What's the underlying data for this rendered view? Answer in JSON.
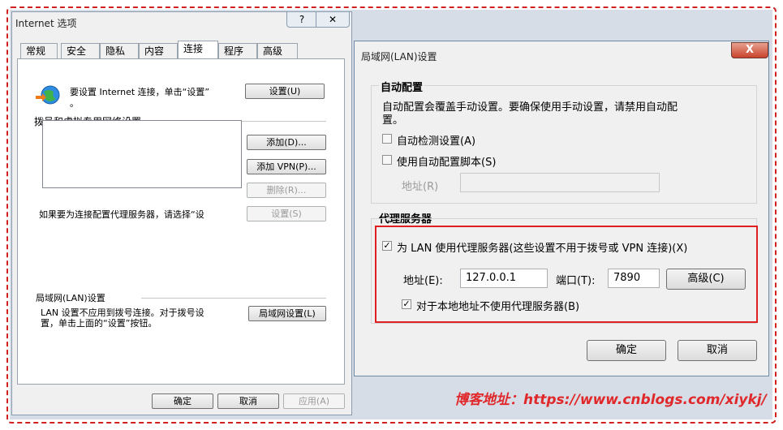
{
  "internet_options": {
    "title": "Internet 选项",
    "help_label": "?",
    "close_label": "✕",
    "tabs": [
      "常规",
      "安全",
      "隐私",
      "内容",
      "连接",
      "程序",
      "高级"
    ],
    "active_tab": "连接",
    "setup_text_1": "要设置 Internet 连接，单击“设置”",
    "setup_text_2": "。",
    "setup_button": "设置(U)",
    "dialup_group": "拨号和虚拟专用网络设置",
    "add_button": "添加(D)...",
    "add_vpn_button": "添加 VPN(P)...",
    "remove_button": "删除(R)...",
    "settings_button": "设置(S)",
    "proxy_hint": "如果要为连接配置代理服务器，请选择“设",
    "lan_group": "局域网(LAN)设置",
    "lan_text_1": "LAN 设置不应用到拨号连接。对于拨号设",
    "lan_text_2": "置，单击上面的“设置”按钮。",
    "lan_button": "局域网设置(L)",
    "ok_button": "确定",
    "cancel_button": "取消",
    "apply_button": "应用(A)"
  },
  "lan_settings": {
    "title": "局域网(LAN)设置",
    "close_label": "X",
    "auto_config_title": "自动配置",
    "auto_config_desc_1": "自动配置会覆盖手动设置。要确保使用手动设置，请禁用自动配",
    "auto_config_desc_2": "置。",
    "auto_detect_label": "自动检测设置(A)",
    "auto_detect_checked": false,
    "use_script_label": "使用自动配置脚本(S)",
    "use_script_checked": false,
    "script_address_label": "地址(R)",
    "script_address_value": "",
    "proxy_title": "代理服务器",
    "use_proxy_label": "为 LAN 使用代理服务器(这些设置不用于拨号或 VPN 连接)(X)",
    "use_proxy_checked": true,
    "address_label": "地址(E):",
    "address_value": "127.0.0.1",
    "port_label": "端口(T):",
    "port_value": "7890",
    "advanced_button": "高级(C)",
    "bypass_local_label": "对于本地地址不使用代理服务器(B)",
    "bypass_local_checked": true,
    "ok_button": "确定",
    "cancel_button": "取消"
  },
  "footer": {
    "blog_text": "博客地址：https://www.cnblogs.com/xiykj/"
  },
  "colors": {
    "highlight_red": "#e02020",
    "footer_red": "#e0282a"
  }
}
